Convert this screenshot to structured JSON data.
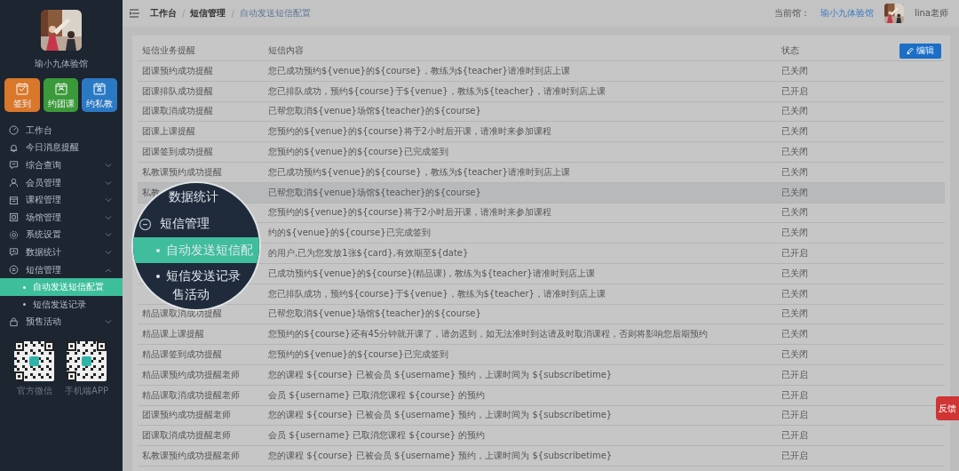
{
  "sidebar": {
    "venue_name": "瑜小九体验馆",
    "quick_actions": [
      {
        "label": "签到",
        "color": "#d9772b"
      },
      {
        "label": "约团课",
        "color": "#3a9a3a"
      },
      {
        "label": "约私教",
        "color": "#2a79c4"
      }
    ],
    "menu": [
      {
        "label": "工作台"
      },
      {
        "label": "今日消息提醒"
      },
      {
        "label": "综合查询",
        "expanded": false
      },
      {
        "label": "会员管理",
        "expanded": false
      },
      {
        "label": "课程管理",
        "expanded": false
      },
      {
        "label": "场馆管理",
        "expanded": false
      },
      {
        "label": "系统设置",
        "expanded": false
      },
      {
        "label": "数据统计",
        "expanded": false
      },
      {
        "label": "短信管理",
        "expanded": true,
        "children": [
          {
            "label": "自动发送短信配置",
            "selected": true
          },
          {
            "label": "短信发送记录",
            "selected": false
          }
        ]
      },
      {
        "label": "预售活动",
        "expanded": false
      }
    ],
    "qr_codes": [
      {
        "caption": "官方微信"
      },
      {
        "caption": "手机端APP"
      }
    ]
  },
  "top_bar": {
    "breadcrumb": [
      {
        "label": "工作台",
        "current": false
      },
      {
        "label": "短信管理",
        "current": false
      },
      {
        "label": "自动发送短信配置",
        "current": true
      }
    ],
    "separator": "/",
    "venue_label": "当前馆：",
    "venue_name": "瑜小九体验馆",
    "user_name": "lina老师"
  },
  "table": {
    "columns": [
      "短信业务提醒",
      "短信内容",
      "状态"
    ],
    "edit_button": "编辑",
    "rows": [
      {
        "name": "团课预约成功提醒",
        "content": "您已成功预约${venue}的${course}，教练为${teacher}请准时到店上课",
        "status": "已关闭",
        "hovered": false
      },
      {
        "name": "团课排队成功提醒",
        "content": "您已排队成功，预约${course}于${venue}，教练为${teacher}，请准时到店上课",
        "status": "已开启",
        "hovered": false
      },
      {
        "name": "团课取消成功提醒",
        "content": "已帮您取消${venue}场馆${teacher}的${course}",
        "status": "已关闭",
        "hovered": false
      },
      {
        "name": "团课上课提醒",
        "content": "您预约的${venue}的${course}将于2小时后开课，请准时来参加课程",
        "status": "已关闭",
        "hovered": false
      },
      {
        "name": "团课签到成功提醒",
        "content": "您预约的${venue}的${course}已完成签到",
        "status": "已关闭",
        "hovered": false
      },
      {
        "name": "私教课预约成功提醒",
        "content": "您已成功预约${venue}的${course}，教练为${teacher}请准时到店上课",
        "status": "已关闭",
        "hovered": false
      },
      {
        "name": "私教",
        "content": "已帮您取消${venue}场馆${teacher}的${course}",
        "status": "已关闭",
        "hovered": true
      },
      {
        "content": "您预约的${venue}的${course}将于2小时后开课，请准时来参加课程",
        "status": "已关闭",
        "hovered": false
      },
      {
        "content": "约的${venue}的${course}已完成签到",
        "status": "已关闭",
        "hovered": false
      },
      {
        "content": "的用户,已为您发放1张${card},有效期至${date}",
        "status": "已开启",
        "hovered": false
      },
      {
        "content": "已成功预约${venue}的${course}(精品课)，教练为${teacher}请准时到店上课",
        "status": "已关闭",
        "hovered": false
      },
      {
        "content": "您已排队成功，预约${course}于${venue}，教练为${teacher}，请准时到店上课",
        "status": "已关闭",
        "hovered": false
      },
      {
        "name": "精品课取消成功提醒",
        "content": "已帮您取消${venue}场馆${teacher}的${course}",
        "status": "已关闭",
        "hovered": false
      },
      {
        "name": "精品课上课提醒",
        "content": "您预约的${course}还有45分钟就开课了，请勿迟到，如无法准时到达请及时取消课程，否则将影响您后期预约",
        "status": "已关闭",
        "hovered": false
      },
      {
        "name": "精品课签到成功提醒",
        "content": "您预约的${venue}的${course}已完成签到",
        "status": "已关闭",
        "hovered": false
      },
      {
        "name": "精品课预约成功提醒老师",
        "content": "您的课程 ${course} 已被会员 ${username} 预约，上课时间为 ${subscribetime}",
        "status": "已开启",
        "hovered": false
      },
      {
        "name": "精品课取消成功提醒老师",
        "content": "会员 ${username} 已取消您课程 ${course} 的预约",
        "status": "已开启",
        "hovered": false
      },
      {
        "name": "团课预约成功提醒老师",
        "content": "您的课程 ${course} 已被会员 ${username} 预约，上课时间为 ${subscribetime}",
        "status": "已开启",
        "hovered": false
      },
      {
        "name": "团课取消成功提醒老师",
        "content": "会员 ${username} 已取消您课程 ${course} 的预约",
        "status": "已开启",
        "hovered": false
      },
      {
        "name": "私教课预约成功提醒老师",
        "content": "您的课程 ${course} 已被会员 ${username} 预约，上课时间为 ${subscribetime}",
        "status": "已开启",
        "hovered": false
      }
    ]
  },
  "magnifier": {
    "items": [
      {
        "label": "数据统计",
        "kind": "plain"
      },
      {
        "label": "短信管理",
        "kind": "group"
      },
      {
        "label": "自动发送短信配",
        "kind": "child",
        "selected": true
      },
      {
        "label": "短信发送记录",
        "kind": "child",
        "selected": false
      },
      {
        "label": "售活动",
        "kind": "plain"
      }
    ]
  },
  "feedback_tab": "反馈"
}
